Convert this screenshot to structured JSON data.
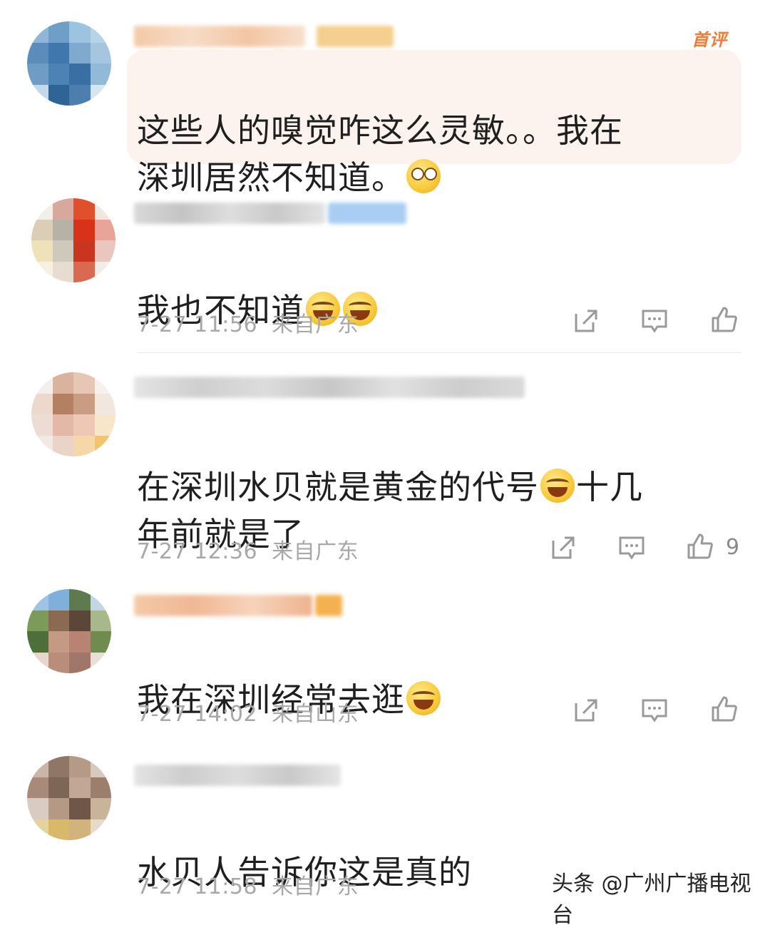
{
  "comments": [
    {
      "text": "这些人的嗅觉咋这么灵敏。。我在\n深圳居然不知道。",
      "emoji": "rolling-eyes-icon",
      "badge": "首评"
    },
    {
      "text": "我也不知道",
      "emojis": [
        "laughing-tears-icon",
        "laughing-tears-icon"
      ],
      "time": "7-27 11:56",
      "location": "来自广东"
    },
    {
      "text_a": "在深圳水贝就是黄金的代号",
      "text_b": "十几\n年前就是了",
      "time": "7-27 12:36",
      "location": "来自广东",
      "likes": "9"
    },
    {
      "text": "我在深圳经常去逛",
      "time": "7-27 14:02",
      "location": "来自山东"
    },
    {
      "text": "水贝人告诉你这是真的",
      "time": "7-27 11:58",
      "location": "来自广东"
    }
  ],
  "watermark": "头条 @广州广播电视台",
  "colors": {
    "badge": "#f07c3a",
    "highlight_bg": "#fdf3ee",
    "meta": "#a8a8a8"
  }
}
